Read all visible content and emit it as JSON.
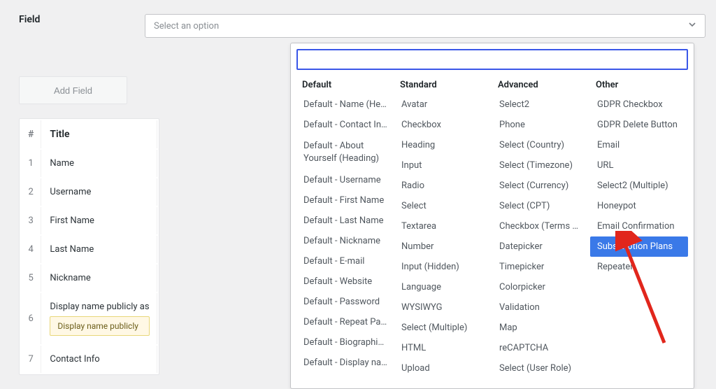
{
  "field_label": "Field",
  "select": {
    "placeholder": "Select an option"
  },
  "add_field_label": "Add Field",
  "table": {
    "head_num": "#",
    "head_title": "Title",
    "rows": [
      {
        "n": "1",
        "title": "Name"
      },
      {
        "n": "2",
        "title": "Username"
      },
      {
        "n": "3",
        "title": "First Name"
      },
      {
        "n": "4",
        "title": "Last Name"
      },
      {
        "n": "5",
        "title": "Nickname"
      },
      {
        "n": "6",
        "title": "Display name publicly as",
        "warn": "Display name publicly"
      },
      {
        "n": "7",
        "title": "Contact Info"
      }
    ]
  },
  "dropdown": {
    "groups": {
      "default": {
        "label": "Default",
        "items": [
          "Default - Name (Heading)",
          "Default - Contact Info (Heading)",
          "Default - About Yourself (Heading)",
          "Default - Username",
          "Default - First Name",
          "Default - Last Name",
          "Default - Nickname",
          "Default - E-mail",
          "Default - Website",
          "Default - Password",
          "Default - Repeat Password",
          "Default - Biographical Info",
          "Default - Display name publicly as"
        ]
      },
      "standard": {
        "label": "Standard",
        "items": [
          "Avatar",
          "Checkbox",
          "Heading",
          "Input",
          "Radio",
          "Select",
          "Textarea",
          "Number",
          "Input (Hidden)",
          "Language",
          "WYSIWYG",
          "Select (Multiple)",
          "HTML",
          "Upload"
        ]
      },
      "advanced": {
        "label": "Advanced",
        "items": [
          "Select2",
          "Phone",
          "Select (Country)",
          "Select (Timezone)",
          "Select (Currency)",
          "Select (CPT)",
          "Checkbox (Terms and Conditions)",
          "Datepicker",
          "Timepicker",
          "Colorpicker",
          "Validation",
          "Map",
          "reCAPTCHA",
          "Select (User Role)"
        ]
      },
      "other": {
        "label": "Other",
        "items": [
          "GDPR Checkbox",
          "GDPR Delete Button",
          "Email",
          "URL",
          "Select2 (Multiple)",
          "Honeypot",
          "Email Confirmation",
          "Subscription Plans",
          "Repeater"
        ],
        "highlight_index": 7
      }
    }
  }
}
